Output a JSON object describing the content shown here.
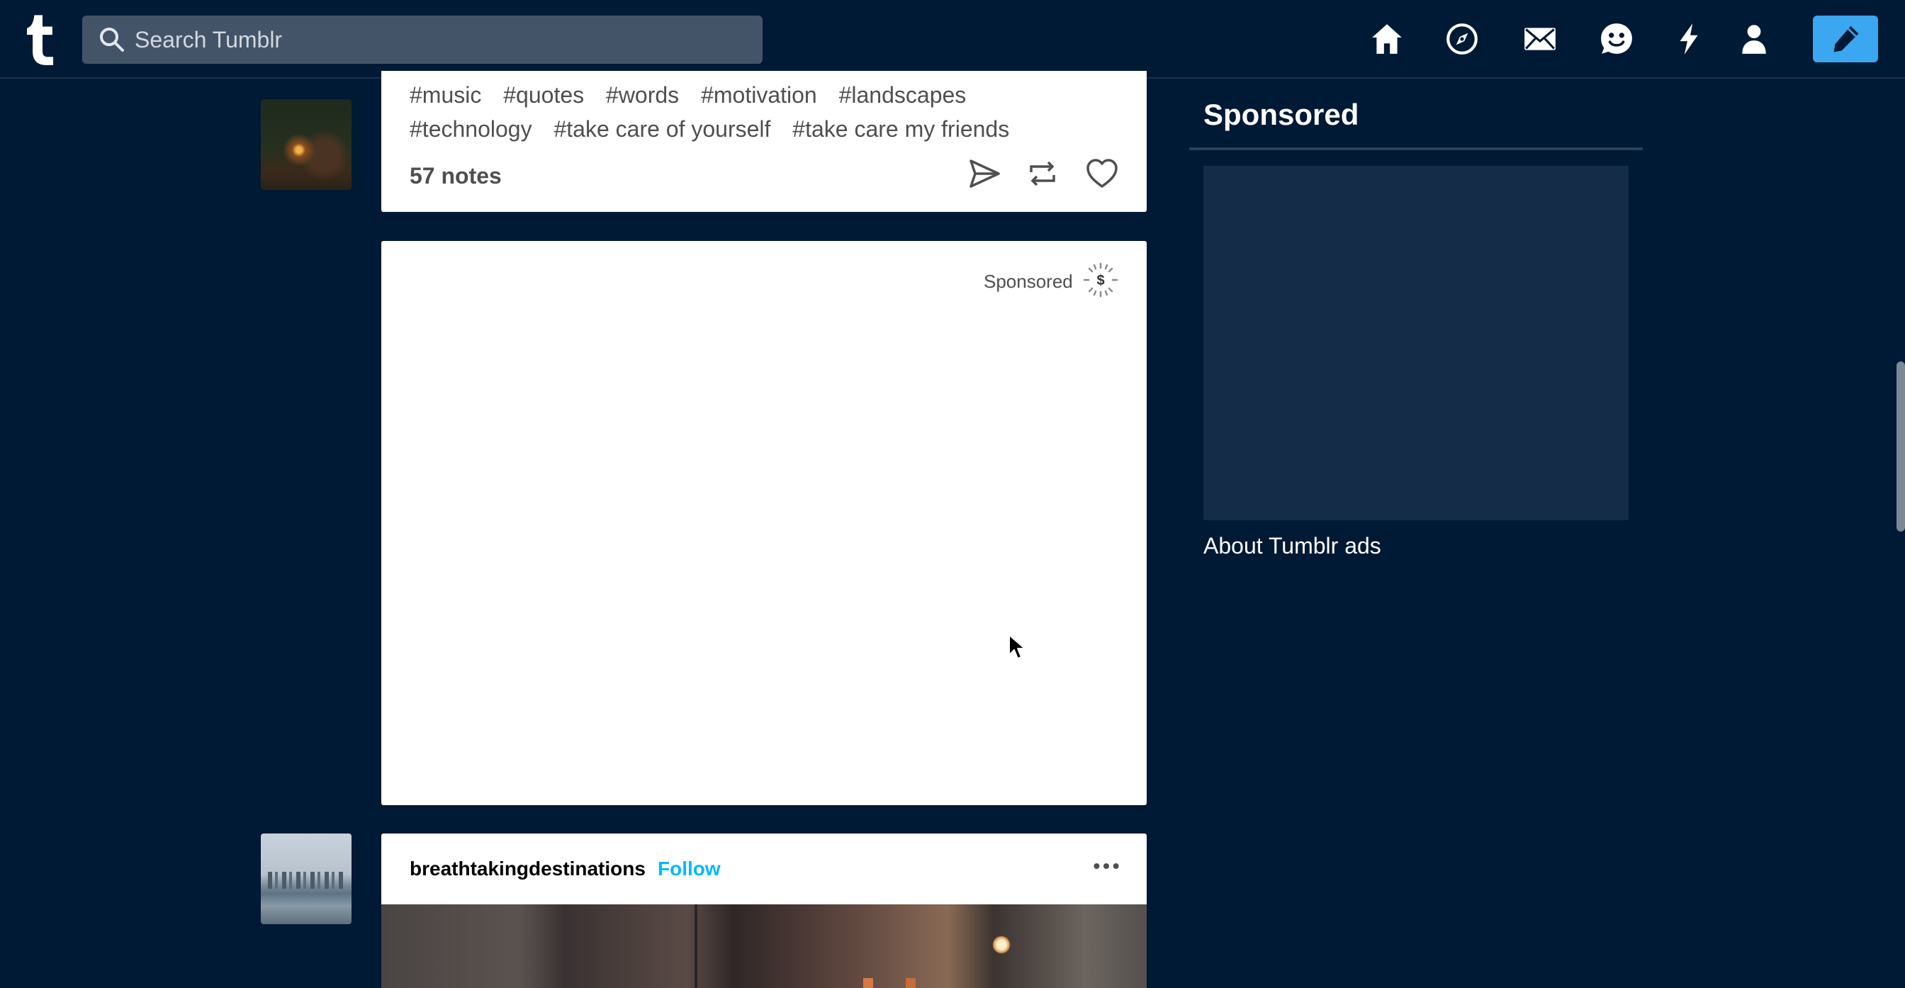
{
  "topbar": {
    "logo_icon": "tumblr-logo-icon",
    "search_placeholder": "Search Tumblr",
    "nav_icons": [
      "home-icon",
      "explore-icon",
      "inbox-icon",
      "messaging-icon",
      "activity-icon",
      "account-icon"
    ],
    "compose_icon": "pencil-icon"
  },
  "feed": {
    "first_post": {
      "tags": [
        "#music",
        "#quotes",
        "#words",
        "#motivation",
        "#landscapes",
        "#technology",
        "#take care of yourself",
        "#take care my friends"
      ],
      "notes": "57 notes",
      "actions": [
        "share-icon",
        "reblog-icon",
        "like-icon"
      ]
    },
    "ad_post": {
      "label": "Sponsored"
    },
    "second_post": {
      "blog_name": "breathtakingdestinations",
      "follow_label": "Follow"
    }
  },
  "sidebar": {
    "title": "Sponsored",
    "about_link": "About Tumblr ads"
  },
  "colors": {
    "background": "#001935",
    "search_bg": "#445468",
    "accent": "#3aa7f0",
    "follow": "#00b8ff",
    "ad_placeholder": "#142c47"
  }
}
